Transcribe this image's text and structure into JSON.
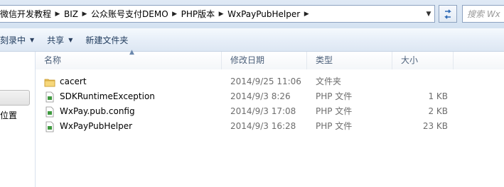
{
  "address_bar": {
    "crumbs": [
      "微信开发教程",
      "BIZ",
      "公众账号支付DEMO",
      "PHP版本",
      "WxPayPubHelper"
    ],
    "search_placeholder": "搜索 Wx"
  },
  "toolbar": {
    "burn_label": "刻录中",
    "share_label": "共享",
    "new_folder_label": "新建文件夹"
  },
  "nav": {
    "visible_label": "位置"
  },
  "columns": {
    "name": "名称",
    "modified": "修改日期",
    "type": "类型",
    "size": "大小"
  },
  "files": [
    {
      "name": "cacert",
      "modified": "2014/9/25 11:06",
      "type": "文件夹",
      "size": "",
      "icon": "folder-icon"
    },
    {
      "name": "SDKRuntimeException",
      "modified": "2014/9/3 8:26",
      "type": "PHP 文件",
      "size": "1 KB",
      "icon": "php-file-icon"
    },
    {
      "name": "WxPay.pub.config",
      "modified": "2014/9/3 17:08",
      "type": "PHP 文件",
      "size": "2 KB",
      "icon": "php-file-icon"
    },
    {
      "name": "WxPayPubHelper",
      "modified": "2014/9/3 16:28",
      "type": "PHP 文件",
      "size": "23 KB",
      "icon": "php-file-icon"
    }
  ],
  "colors": {
    "addressbar_bg": "#d8e5f3",
    "toolbar_text": "#1e395b",
    "header_text": "#4c607a",
    "detail_text": "#6d6d6d"
  }
}
